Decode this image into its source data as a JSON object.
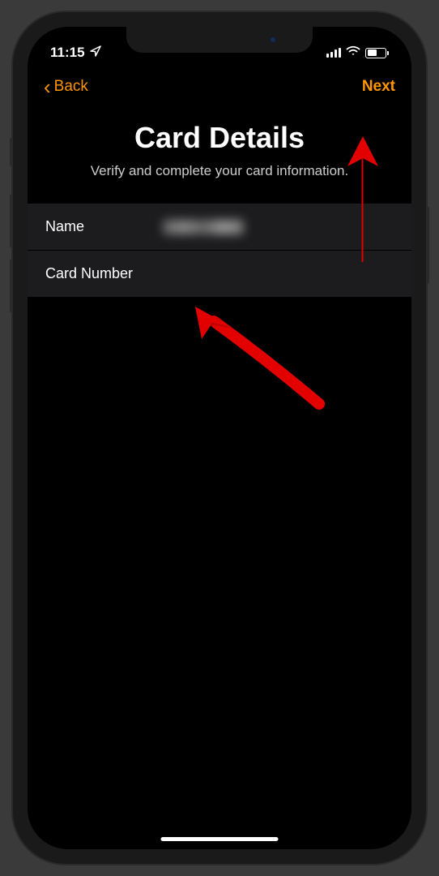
{
  "statusBar": {
    "time": "11:15",
    "locationActive": true
  },
  "nav": {
    "backLabel": "Back",
    "nextLabel": "Next"
  },
  "header": {
    "title": "Card Details",
    "subtitle": "Verify and complete your card information."
  },
  "form": {
    "nameField": {
      "label": "Name",
      "value": "████ ████"
    },
    "cardNumberField": {
      "label": "Card Number",
      "value": ""
    }
  },
  "colors": {
    "accent": "#ff9500",
    "background": "#000000",
    "rowBackground": "#1c1c1e"
  }
}
